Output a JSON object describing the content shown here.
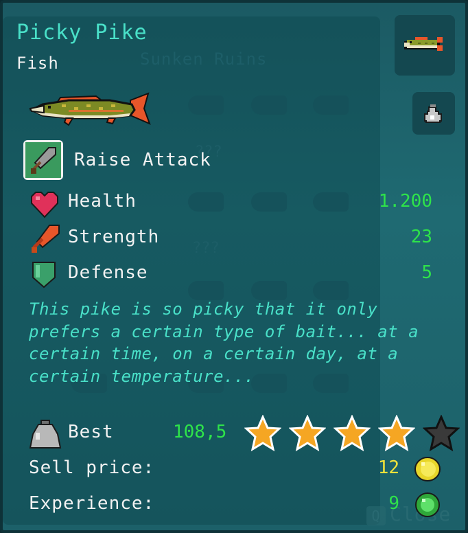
{
  "background": {
    "ghost_title": "Sunken Ruins",
    "ghost_unknown": "???",
    "close_key": "Q",
    "close_label": "Close"
  },
  "item": {
    "name": "Picky Pike",
    "category": "Fish",
    "ability": "Raise Attack",
    "description": "This pike is so picky that it only prefers a certain type of bait... at a certain time, on a certain day, at a certain temperature..."
  },
  "stats": [
    {
      "label": "Health",
      "value": "1.200",
      "icon": "heart-icon"
    },
    {
      "label": "Strength",
      "value": "23",
      "icon": "sword-icon"
    },
    {
      "label": "Defense",
      "value": "5",
      "icon": "shield-icon"
    }
  ],
  "record": {
    "label": "Best",
    "value": "108,5",
    "stars_filled": 4,
    "stars_total": 5
  },
  "sell": {
    "label": "Sell price:",
    "value": "12",
    "icon": "gold-coin-icon"
  },
  "experience": {
    "label": "Experience:",
    "value": "9",
    "icon": "green-orb-icon"
  },
  "colors": {
    "title": "#49e0c8",
    "stat_value": "#2ee34a",
    "gold": "#f0e23a",
    "star": "#f5a623"
  }
}
